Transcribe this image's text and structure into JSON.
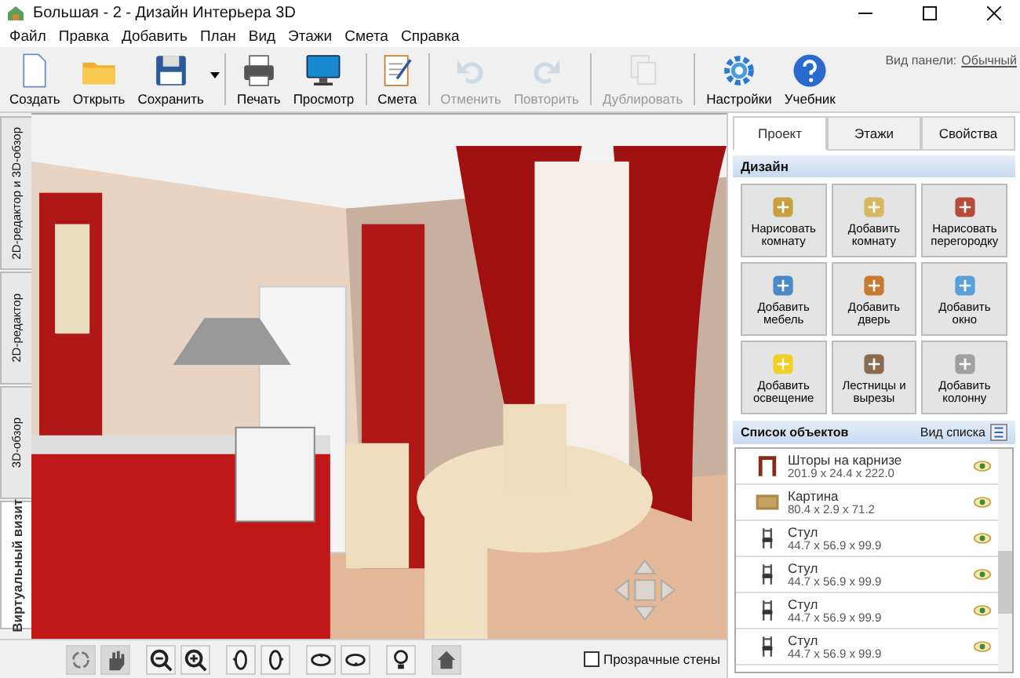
{
  "window": {
    "title": "Большая - 2 - Дизайн Интерьера 3D"
  },
  "menu": [
    "Файл",
    "Правка",
    "Добавить",
    "План",
    "Вид",
    "Этажи",
    "Смета",
    "Справка"
  ],
  "toolbar": {
    "groups": [
      [
        {
          "label": "Создать",
          "disabled": false
        },
        {
          "label": "Открыть",
          "disabled": false
        },
        {
          "label": "Сохранить",
          "disabled": false
        }
      ],
      [
        {
          "label": "Печать",
          "disabled": false
        },
        {
          "label": "Просмотр",
          "disabled": false
        }
      ],
      [
        {
          "label": "Смета",
          "disabled": false
        }
      ],
      [
        {
          "label": "Отменить",
          "disabled": true
        },
        {
          "label": "Повторить",
          "disabled": true
        }
      ],
      [
        {
          "label": "Дублировать",
          "disabled": true
        }
      ],
      [
        {
          "label": "Настройки",
          "disabled": false
        },
        {
          "label": "Учебник",
          "disabled": false
        }
      ]
    ],
    "panel_view_label": "Вид панели:",
    "panel_view_link": "Обычный"
  },
  "view_tabs": [
    {
      "label": "2D-редактор и 3D-обзор",
      "selected": false
    },
    {
      "label": "2D-редактор",
      "selected": false
    },
    {
      "label": "3D-обзор",
      "selected": false
    },
    {
      "label": "Виртуальный визит",
      "selected": true
    }
  ],
  "panel": {
    "tabs": [
      {
        "label": "Проект",
        "selected": true
      },
      {
        "label": "Этажи",
        "selected": false
      },
      {
        "label": "Свойства",
        "selected": false
      }
    ],
    "design_title": "Дизайн",
    "design_buttons": [
      "Нарисовать комнату",
      "Добавить комнату",
      "Нарисовать перегородку",
      "Добавить мебель",
      "Добавить дверь",
      "Добавить окно",
      "Добавить освещение",
      "Лестницы и вырезы",
      "Добавить колонну"
    ],
    "objects_title": "Список объектов",
    "list_view_label": "Вид списка",
    "objects": [
      {
        "kind": "curtain",
        "name": "Шторы на карнизе",
        "size": "201.9 x 24.4 x 222.0"
      },
      {
        "kind": "picture",
        "name": "Картина",
        "size": "80.4 x 2.9 x 71.2"
      },
      {
        "kind": "chair",
        "name": "Стул",
        "size": "44.7 x 56.9 x 99.9"
      },
      {
        "kind": "chair",
        "name": "Стул",
        "size": "44.7 x 56.9 x 99.9"
      },
      {
        "kind": "chair",
        "name": "Стул",
        "size": "44.7 x 56.9 x 99.9"
      },
      {
        "kind": "chair",
        "name": "Стул",
        "size": "44.7 x 56.9 x 99.9"
      }
    ]
  },
  "bottom_bar": {
    "transparent_walls": {
      "label": "Прозрачные стены",
      "checked": false
    }
  }
}
